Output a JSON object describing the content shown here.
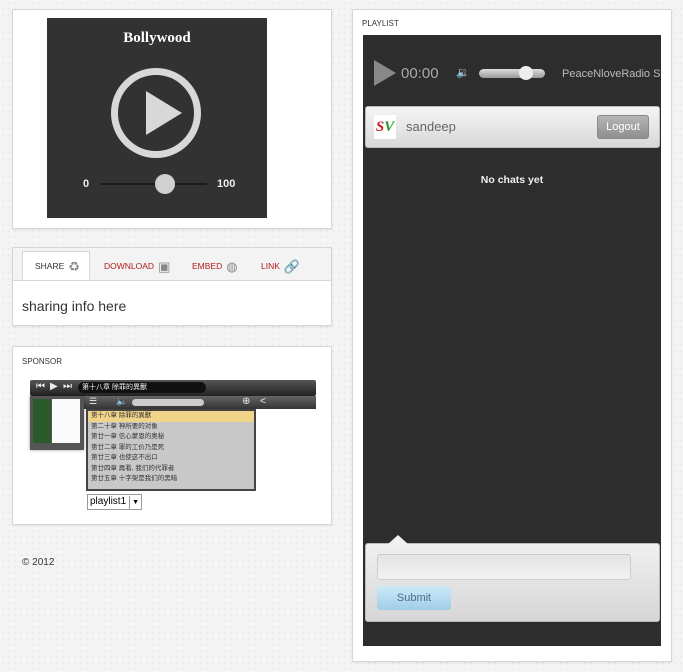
{
  "player": {
    "title": "Bollywood",
    "volume_min": "0",
    "volume_max": "100",
    "volume_level": 0.6
  },
  "share": {
    "tabs": [
      {
        "label": "SHARE",
        "icon": "recycle-icon",
        "active": true
      },
      {
        "label": "DOWNLOAD",
        "icon": "film-icon",
        "active": false
      },
      {
        "label": "EMBED",
        "icon": "globe-icon",
        "active": false
      },
      {
        "label": "LINK",
        "icon": "chain-link-icon",
        "active": false
      }
    ],
    "content": "sharing info here"
  },
  "sponsor": {
    "heading": "SPONSOR",
    "now_playing": "第十八章 除罪的異獸",
    "tracks": [
      "第十八章 除罪的異獸",
      "第二十章 神所要的对象",
      "第廿一章 信心蒙恩的奥秘",
      "第廿二章 罪的工价乃是死",
      "第廿三章 也使这不出口",
      "第廿四章 再看, 我们的代罪者",
      "第廿五章 十字架是我们的黑暗"
    ],
    "selected_track_index": 0,
    "playlist_select": "playlist1"
  },
  "footer": {
    "copyright": "© 2012"
  },
  "playlist": {
    "heading": "PLAYLIST",
    "radio": {
      "time": "00:00",
      "station": "PeaceNloveRadio S",
      "volume_level": 0.7
    },
    "user": {
      "logo_s": "S",
      "logo_v": "V",
      "name": "sandeep",
      "logout_label": "Logout"
    },
    "empty_message": "No chats yet",
    "submit_label": "Submit"
  }
}
